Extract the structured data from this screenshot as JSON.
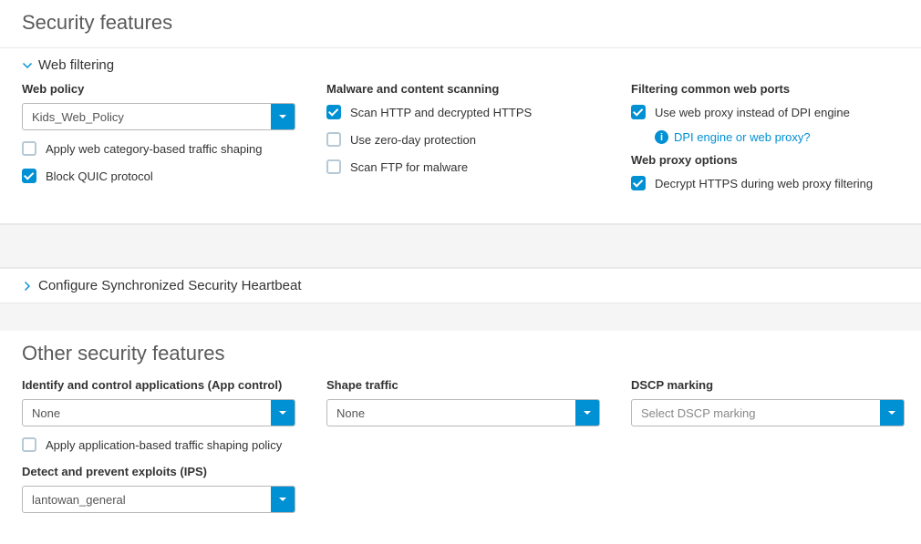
{
  "section_security": "Security features",
  "web_filtering": {
    "title": "Web filtering",
    "policy_label": "Web policy",
    "policy_value": "Kids_Web_Policy",
    "apply_category_label": "Apply web category-based traffic shaping",
    "block_quic_label": "Block QUIC protocol",
    "malware_label": "Malware and content scanning",
    "scan_http_label": "Scan HTTP and decrypted HTTPS",
    "zero_day_label": "Use zero-day protection",
    "scan_ftp_label": "Scan FTP for malware",
    "ports_label": "Filtering common web ports",
    "use_proxy_label": "Use web proxy instead of DPI engine",
    "help_link": "DPI engine or web proxy?",
    "proxy_options_label": "Web proxy options",
    "decrypt_https_label": "Decrypt HTTPS during web proxy filtering"
  },
  "sync_heartbeat": "Configure Synchronized Security Heartbeat",
  "section_other": "Other security features",
  "app_control": {
    "label": "Identify and control applications (App control)",
    "value": "None",
    "apply_label": "Apply application-based traffic shaping policy"
  },
  "shape_traffic": {
    "label": "Shape traffic",
    "value": "None"
  },
  "dscp": {
    "label": "DSCP marking",
    "placeholder": "Select DSCP marking"
  },
  "ips": {
    "label": "Detect and prevent exploits (IPS)",
    "value": "lantowan_general"
  }
}
